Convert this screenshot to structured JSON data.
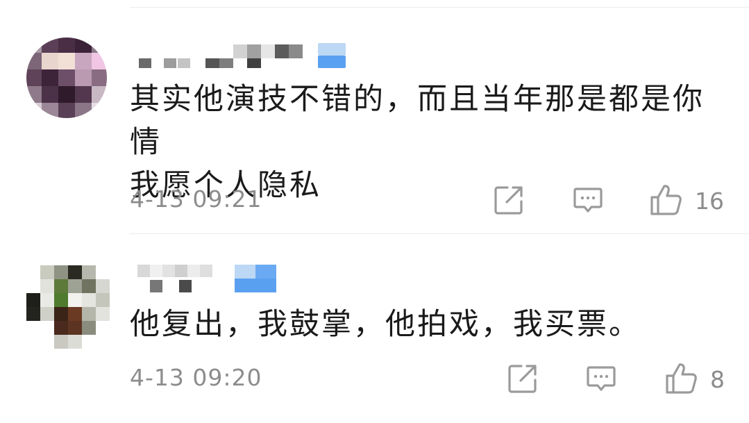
{
  "comments": [
    {
      "text": "其实他演技不错的，而且当年那是都是你情\n我愿个人隐私",
      "timestamp": "4-13 09:21",
      "likes": "16",
      "icons": [
        "share-icon",
        "reply-icon",
        "thumbs-up-icon"
      ]
    },
    {
      "text": "他复出，我鼓掌，他拍戏，我买票。",
      "timestamp": "4-13 09:20",
      "likes": "8",
      "icons": [
        "share-icon",
        "reply-icon",
        "thumbs-up-icon"
      ]
    }
  ],
  "colors": {
    "text": "#1a1a1a",
    "meta": "#8c8c8c",
    "icon": "#9a9a9a",
    "badge": "#5aa0f0",
    "divider": "#ececec"
  }
}
